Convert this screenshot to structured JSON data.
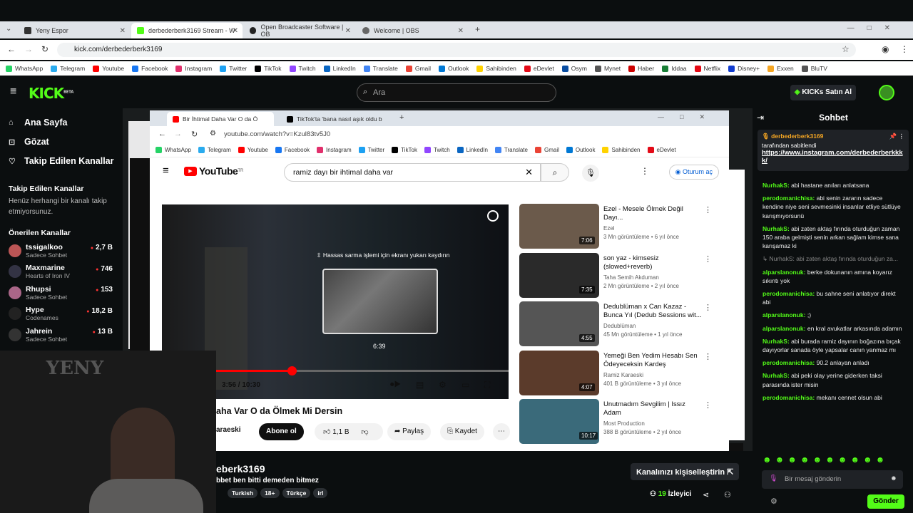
{
  "window": {
    "controls": [
      "—",
      "□",
      "✕"
    ]
  },
  "tabs": [
    {
      "label": "Yeny Espor",
      "color": "#333"
    },
    {
      "label": "derbederberk3169 Stream - W",
      "color": "#53fc18",
      "active": true
    },
    {
      "label": "Open Broadcaster Software | OB",
      "color": "#222"
    },
    {
      "label": "Welcome | OBS",
      "color": "#666"
    }
  ],
  "address": {
    "url": "kick.com/derbederberk3169"
  },
  "bookmarks": [
    "WhatsApp",
    "Telegram",
    "Youtube",
    "Facebook",
    "Instagram",
    "Twitter",
    "TikTok",
    "Twitch",
    "LinkedIn",
    "Translate",
    "Gmail",
    "Outlook",
    "Sahibinden",
    "eDevlet",
    "Osym",
    "Mynet",
    "Haber",
    "Iddaa",
    "Netflix",
    "Disney+",
    "Exxen",
    "BluTV"
  ],
  "bookmark_colors": [
    "#25d366",
    "#2aabee",
    "#f00",
    "#1877f2",
    "#e1306c",
    "#1da1f2",
    "#000",
    "#9146ff",
    "#0a66c2",
    "#4285f4",
    "#ea4335",
    "#0078d4",
    "#ffd200",
    "#e30a17",
    "#0a4ea2",
    "#555",
    "#c00",
    "#1a7f37",
    "#e50914",
    "#113ccf",
    "#f5a623",
    "#555"
  ],
  "kick": {
    "logo": "KICK",
    "beta": "BETA",
    "search_placeholder": "Ara",
    "kicks_btn": "KICKs Satın Al"
  },
  "sidebar": {
    "nav": [
      {
        "label": "Ana Sayfa",
        "icon": "⌂"
      },
      {
        "label": "Gözat",
        "icon": "⊡"
      },
      {
        "label": "Takip Edilen Kanallar",
        "icon": "♡"
      }
    ],
    "followed_title": "Takip Edilen Kanallar",
    "followed_empty": "Henüz herhangi bir kanalı takip etmiyorsunuz.",
    "recommended_title": "Önerilen Kanallar",
    "channels": [
      {
        "name": "tssigalkoo",
        "category": "Sadece Sohbet",
        "viewers": "2,7 B",
        "color": "#b55"
      },
      {
        "name": "Maxmarine",
        "category": "Hearts of Iron IV",
        "viewers": "746",
        "color": "#334"
      },
      {
        "name": "Rhupsi",
        "category": "Sadece Sohbet",
        "viewers": "153",
        "color": "#a68"
      },
      {
        "name": "Hype",
        "category": "Codenames",
        "viewers": "18,2 B",
        "color": "#222"
      },
      {
        "name": "Jahrein",
        "category": "Sadece Sohbet",
        "viewers": "13 B",
        "color": "#333"
      }
    ]
  },
  "inner_browser": {
    "tabs": [
      "Bir İhtimal Daha Var O da Ö",
      "TikTok'ta 'bana nasıl aşık oldu b"
    ],
    "url": "youtube.com/watch?v=Kzul83tv5J0",
    "bookmarks": [
      "WhatsApp",
      "Telegram",
      "Youtube",
      "Facebook",
      "Instagram",
      "Twitter",
      "TikTok",
      "Twitch",
      "LinkedIn",
      "Translate",
      "Gmail",
      "Outlook",
      "Sahibinden",
      "eDevlet"
    ]
  },
  "youtube": {
    "logo": "YouTube",
    "region": "TR",
    "search_query": "ramiz dayı bir ihtimal daha var",
    "signin": "Oturum aç",
    "player": {
      "seek_hint": "⇳ Hassas sarma işlemi için ekranı yukarı kaydırın",
      "preview_time": "6:39",
      "time": "3:56 / 10:30",
      "progress": 0.375
    },
    "video_title": "aha Var O da Ölmek Mi Dersin",
    "channel": "araeski",
    "subscribe": "Abone ol",
    "likes": "1,1 B",
    "share": "Paylaş",
    "save": "Kaydet",
    "related": [
      {
        "title": "Ezel - Mesele Ölmek Değil Dayı...",
        "channel": "Ezel",
        "meta": "3 Mn görüntüleme • 6 yıl önce",
        "duration": "7:06",
        "thumb": "#6b5a4b"
      },
      {
        "title": "son yaz - kimsesiz (slowed+reverb)",
        "channel": "Taha Semih Akduman",
        "meta": "",
        "duration": "7:35",
        "thumb": "#2a2a2a",
        "meta2": "2 Mn görüntüleme • 2 yıl önce"
      },
      {
        "title": "Dedublüman x Can Kazaz - Bunca Yıl (Dedub Sessions wit...",
        "channel": "Dedublüman",
        "meta": "45 Mn görüntüleme • 1 yıl önce",
        "duration": "4:55",
        "thumb": "#555"
      },
      {
        "title": "Yemeği Ben Yedim Hesabı Sen Ödeyeceksin Kardeş",
        "channel": "Ramiz Karaeski",
        "meta": "401 B görüntüleme • 3 yıl önce",
        "duration": "4:07",
        "thumb": "#5b3b2b"
      },
      {
        "title": "Unutmadım Sevgilim | Issız Adam",
        "channel": "Most Production",
        "meta": "388 B görüntüleme • 2 yıl önce",
        "duration": "10:17",
        "thumb": "#3a6a7a"
      }
    ]
  },
  "stream": {
    "channel": "eberk3169",
    "title": "bbet ben bitti demeden bitmez",
    "tags": [
      "Turkish",
      "18+",
      "Türkçe",
      "irl"
    ],
    "customize": "Kanalınızı kişiselleştirin",
    "viewers_count": "19",
    "viewers_label": "İzleyici"
  },
  "chat": {
    "title": "Sohbet",
    "pinned_user": "derbederberk3169",
    "pinned_by": "tarafından sabitlendi",
    "pinned_link": "https://www.instagram.com/derbederberkkkk/",
    "messages": [
      {
        "user": "NurhakS",
        "text": "abi hastane anıları anlatsana"
      },
      {
        "user": "perodomanichisa",
        "text": "abi senin zararın sadece kendine niye seni sevmesinki insanlar etliye sütlüye karışmıyorsunü"
      },
      {
        "user": "NurhakS",
        "text": "abi zaten aktaş fırında oturduğun zaman 150 araba gelmişti senin arkan sağlam kimse sana karışamaz ki"
      },
      {
        "user": "",
        "text": "↳ NurhakS: abi zaten aktaş fırında oturduğun za..."
      },
      {
        "user": "alparslanonuk",
        "text": "berke dokunanın amına koyarız sıkıntı yok"
      },
      {
        "user": "perodomanichisa",
        "text": "bu sahne seni anlatıyor direkt abi"
      },
      {
        "user": "alparslanonuk",
        "text": ";)"
      },
      {
        "user": "alparslanonuk",
        "text": "en kral avukatlar arkasında adamın"
      },
      {
        "user": "NurhakS",
        "text": "abi burada ramiz dayının boğazına bıçak dayıyorlar sanada öyle yapsalar canın yanmaz mı"
      },
      {
        "user": "perodomanichisa",
        "text": "90.2 anlayan anladı"
      },
      {
        "user": "NurhakS",
        "text": "abi peki olay yerine giderken taksi parasında ister misin"
      },
      {
        "user": "perodomanichisa",
        "text": "mekanı cennet olsun abi"
      }
    ],
    "input_placeholder": "Bir mesaj gönderin",
    "send": "Gönder"
  },
  "overlay": {
    "logo": "YENY"
  }
}
